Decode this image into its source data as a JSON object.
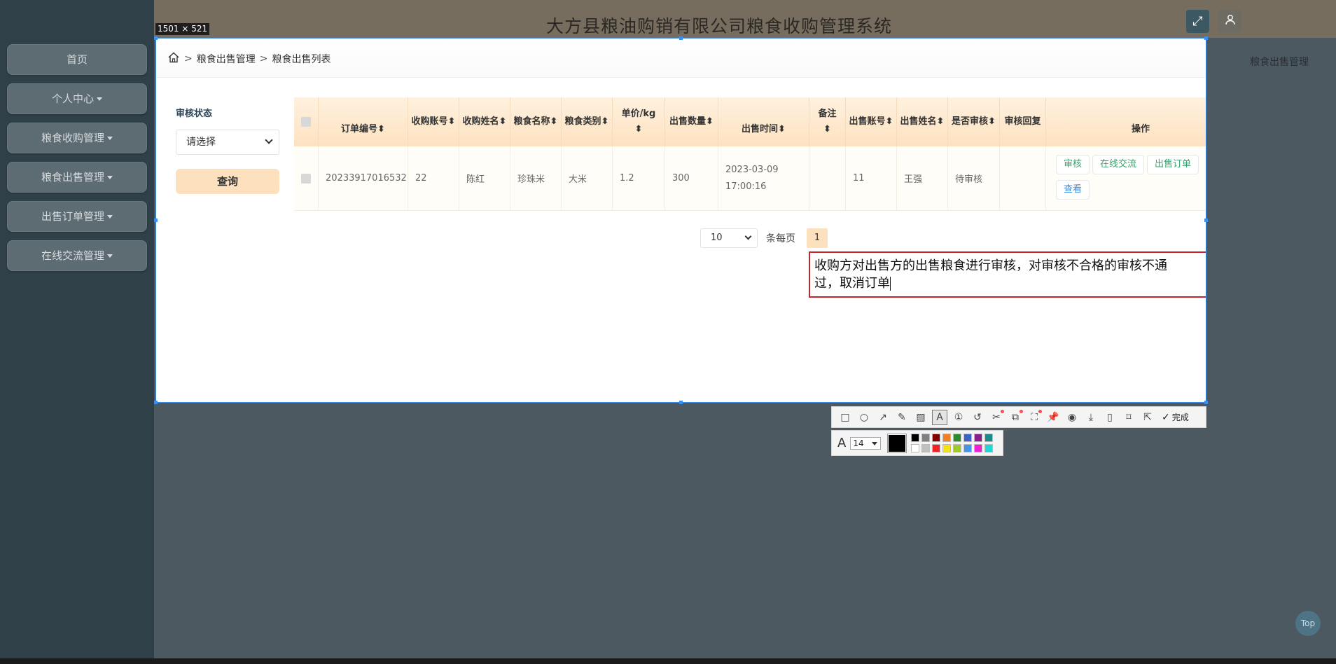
{
  "app": {
    "title": "大方县粮油购销有限公司粮食收购管理系统",
    "right_crumb": "粮食出售管理"
  },
  "sidebar": {
    "items": [
      {
        "label": "首页",
        "dropdown": false
      },
      {
        "label": "个人中心",
        "dropdown": true
      },
      {
        "label": "粮食收购管理",
        "dropdown": true
      },
      {
        "label": "粮食出售管理",
        "dropdown": true
      },
      {
        "label": "出售订单管理",
        "dropdown": true
      },
      {
        "label": "在线交流管理",
        "dropdown": true
      }
    ]
  },
  "capture": {
    "size_label": "1501 × 521"
  },
  "breadcrumb": {
    "level1": "粮食出售管理",
    "level2": "粮食出售列表"
  },
  "filter": {
    "status_label": "审核状态",
    "status_value": "请选择",
    "search_label": "查询"
  },
  "table": {
    "headers": {
      "order_no": "订单编号",
      "buyer_account": "收购账号",
      "buyer_name": "收购姓名",
      "grain_name": "粮食名称",
      "grain_type": "粮食类别",
      "unit_price": "单价/kg",
      "quantity": "出售数量",
      "sale_time": "出售时间",
      "remark": "备注",
      "seller_account": "出售账号",
      "seller_name": "出售姓名",
      "review_status": "是否审核",
      "review_reply": "审核回复",
      "actions": "操作"
    },
    "rows": [
      {
        "order_no": "20233917016532",
        "buyer_account": "22",
        "buyer_name": "陈红",
        "grain_name": "珍珠米",
        "grain_type": "大米",
        "unit_price": "1.2",
        "quantity": "300",
        "sale_date": "2023-03-09",
        "sale_clock": "17:00:16",
        "remark": "",
        "seller_account": "11",
        "seller_name": "王强",
        "review_status": "待审核",
        "review_reply": "",
        "actions": {
          "review": "审核",
          "chat": "在线交流",
          "order": "出售订单",
          "view": "查看"
        }
      }
    ]
  },
  "pagination": {
    "page_size": "10",
    "per_page_label": "条每页",
    "current_page": "1"
  },
  "annotation": {
    "line1": "收购方对出售方的出售粮食进行审核，对审核不合格的审核不通",
    "line2": "过，取消订单"
  },
  "toolbar": {
    "done_label": "完成",
    "font_size": "14",
    "current_color": "#000000",
    "palette": [
      "#000000",
      "#808080",
      "#800000",
      "#f07f28",
      "#2d8a2d",
      "#3c63c8",
      "#8a1f8a",
      "#1a8a8a",
      "#ffffff",
      "#c0c0c0",
      "#ee2424",
      "#f5e219",
      "#9ecb2b",
      "#4696e8",
      "#ee22d0",
      "#22d6d6"
    ]
  },
  "misc": {
    "top_label": "Top"
  }
}
